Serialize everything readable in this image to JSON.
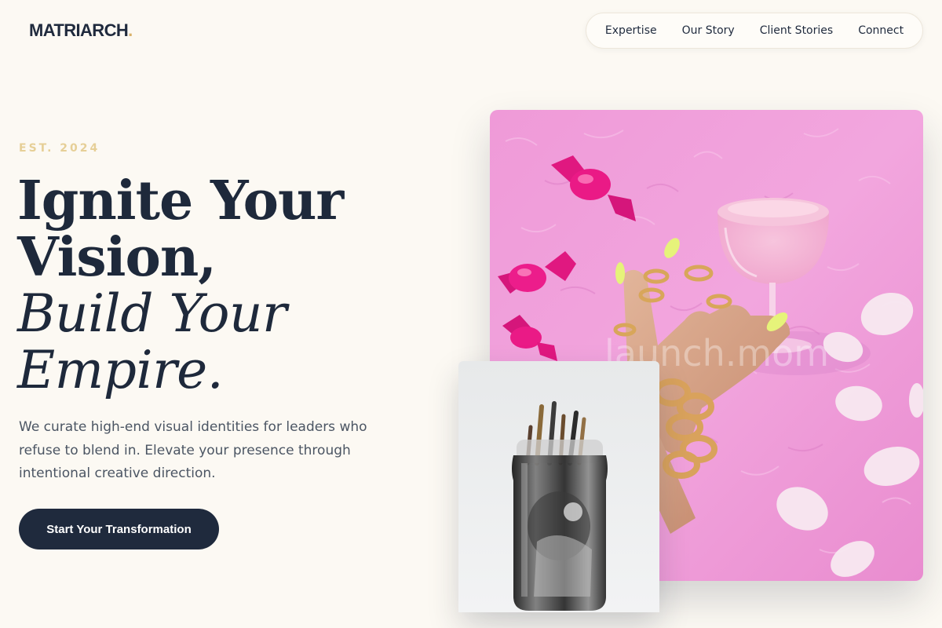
{
  "brand": {
    "name": "MATRIARCH",
    "dot": "."
  },
  "nav": {
    "items": [
      "Expertise",
      "Our Story",
      "Client Stories",
      "Connect"
    ]
  },
  "hero": {
    "eyebrow": "EST. 2024",
    "headline": [
      "Ignite Your",
      "Vision,",
      "Build Your",
      "Empire."
    ],
    "description": "We curate high-end visual identities for leaders who refuse to blend in. Elevate your presence through intentional creative direction.",
    "cta": "Start Your Transformation"
  },
  "images": {
    "primary": "pink-fur-cocktail-photo",
    "secondary": "paintbrush-jar-photo",
    "watermark": "launch.mom"
  },
  "colors": {
    "background": "#fcf9f3",
    "ink": "#1e293b",
    "accent": "#d9b26a",
    "pink": "#f09ad9"
  }
}
